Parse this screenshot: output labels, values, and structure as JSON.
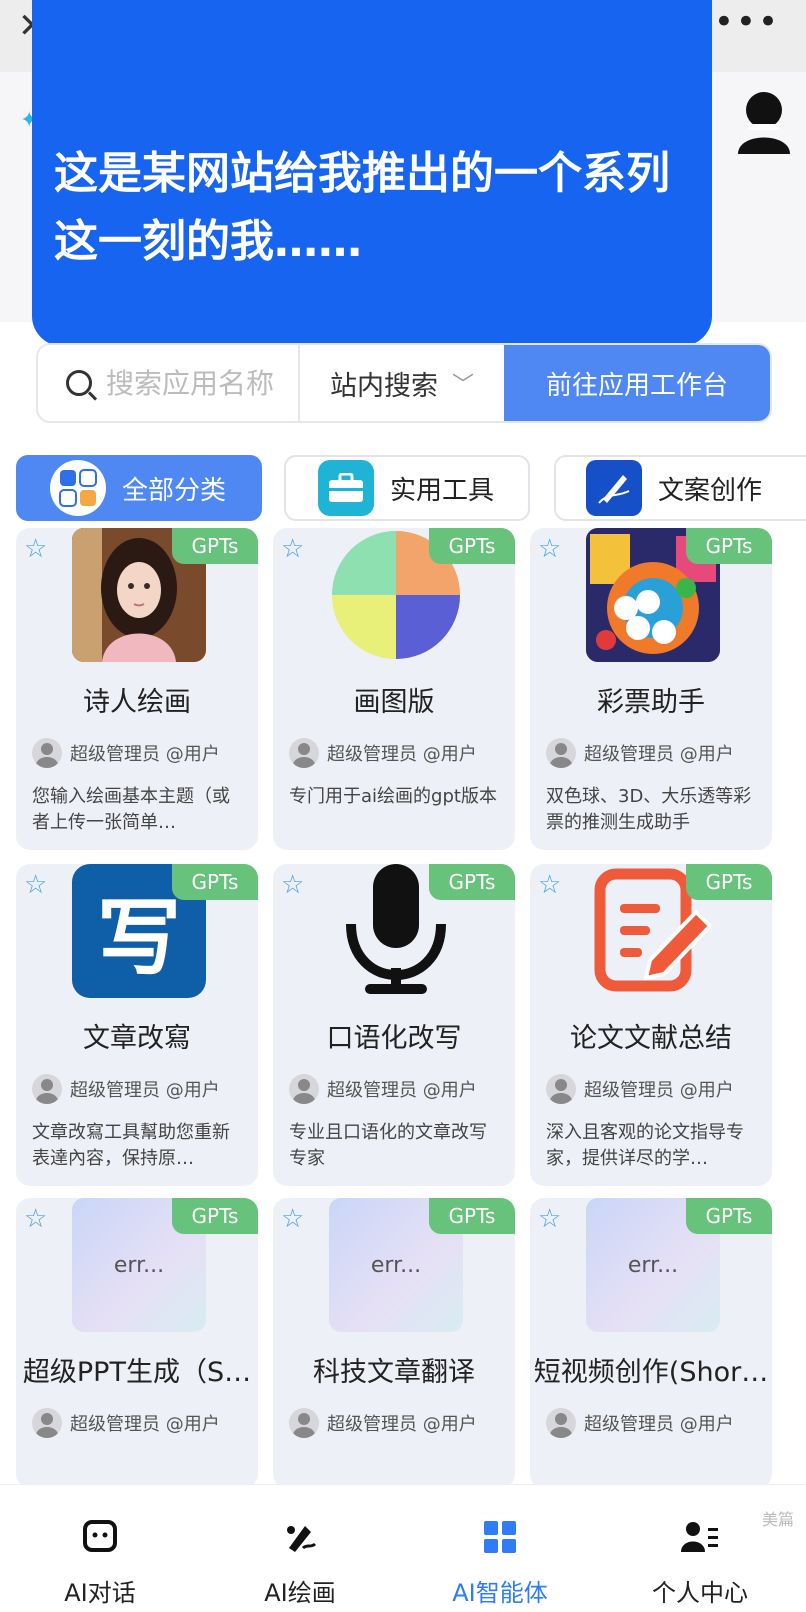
{
  "topbar": {
    "close_icon": "close-icon",
    "more_icon": "more-icon",
    "close_glyph": "✕",
    "more_glyph": "•••"
  },
  "overlay": {
    "text": "这是某网站给我推出的一个系列这一刻的我……"
  },
  "search": {
    "placeholder": "搜索应用名称",
    "scope_label": "站内搜索",
    "go_label": "前往应用工作台"
  },
  "categories": [
    {
      "label": "全部分类",
      "icon": "grid-icon",
      "active": true
    },
    {
      "label": "实用工具",
      "icon": "toolbox-icon",
      "active": false
    },
    {
      "label": "文案创作",
      "icon": "pen-icon",
      "active": false
    }
  ],
  "cards": [
    {
      "tag": "GPTs",
      "title": "诗人绘画",
      "author": "超级管理员",
      "handle": "@用户",
      "desc": "您输入绘画基本主题（或者上传一张简单…",
      "thumb": "portrait-image"
    },
    {
      "tag": "GPTs",
      "title": "画图版",
      "author": "超级管理员",
      "handle": "@用户",
      "desc": "专门用于ai绘画的gpt版本",
      "thumb": "color-wheel-image"
    },
    {
      "tag": "GPTs",
      "title": "彩票助手",
      "author": "超级管理员",
      "handle": "@用户",
      "desc": "双色球、3D、大乐透等彩票的推测生成助手",
      "thumb": "lottery-image"
    },
    {
      "tag": "GPTs",
      "title": "文章改寫",
      "author": "超级管理员",
      "handle": "@用户",
      "desc": "文章改寫工具幫助您重新表達內容，保持原…",
      "thumb": "write-logo",
      "thumb_glyph": "写"
    },
    {
      "tag": "GPTs",
      "title": "口语化改写",
      "author": "超级管理员",
      "handle": "@用户",
      "desc": "专业且口语化的文章改写专家",
      "thumb": "microphone-icon"
    },
    {
      "tag": "GPTs",
      "title": "论文文献总结",
      "author": "超级管理员",
      "handle": "@用户",
      "desc": "深入且客观的论文指导专家，提供详尽的学…",
      "thumb": "edit-document-icon"
    },
    {
      "tag": "GPTs",
      "title": "超级PPT生成（S…",
      "author": "超级管理员",
      "handle": "@用户",
      "desc": "",
      "thumb_text": "err..."
    },
    {
      "tag": "GPTs",
      "title": "科技文章翻译",
      "author": "超级管理员",
      "handle": "@用户",
      "desc": "",
      "thumb_text": "err..."
    },
    {
      "tag": "GPTs",
      "title": "短视频创作(Shor…",
      "author": "超级管理员",
      "handle": "@用户",
      "desc": "",
      "thumb_text": "err..."
    }
  ],
  "bottom_nav": [
    {
      "label": "AI对话",
      "icon": "chat-icon",
      "active": false
    },
    {
      "label": "AI绘画",
      "icon": "brush-icon",
      "active": false
    },
    {
      "label": "AI智能体",
      "icon": "apps-icon",
      "active": true
    },
    {
      "label": "个人中心",
      "icon": "user-icon",
      "active": false
    }
  ],
  "watermark": "美篇",
  "colors": {
    "primary": "#4f88f3",
    "overlay": "#1764f1",
    "tag": "#67c27b",
    "nav_active": "#2f7cf6"
  }
}
